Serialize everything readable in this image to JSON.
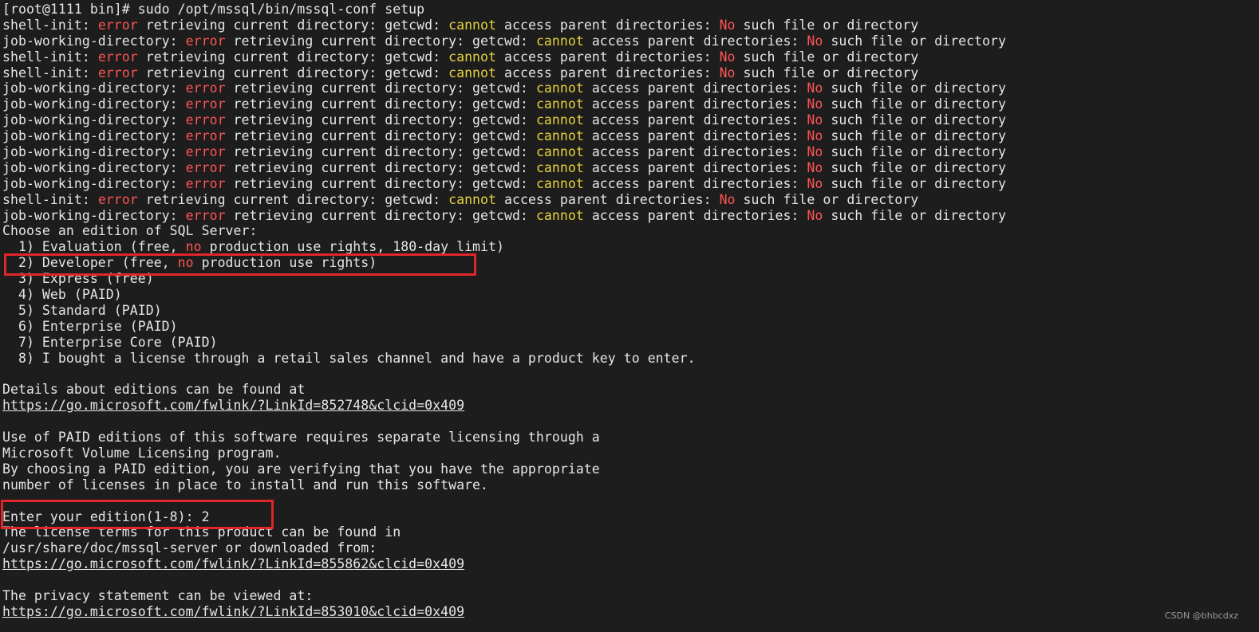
{
  "terminal": {
    "lines": [
      {
        "kind": "prompt",
        "segments": [
          {
            "t": "[root@1111 bin]# sudo /opt/mssql/bin/mssql-conf setup",
            "c": ""
          }
        ]
      },
      {
        "kind": "error",
        "segments": [
          {
            "t": "shell-init: ",
            "c": ""
          },
          {
            "t": "error",
            "c": "red"
          },
          {
            "t": " retrieving current directory: getcwd: ",
            "c": ""
          },
          {
            "t": "cannot",
            "c": "yellow"
          },
          {
            "t": " access parent directories: ",
            "c": ""
          },
          {
            "t": "No",
            "c": "red"
          },
          {
            "t": " such file or directory",
            "c": ""
          }
        ]
      },
      {
        "kind": "error",
        "segments": [
          {
            "t": "job-working-directory: ",
            "c": ""
          },
          {
            "t": "error",
            "c": "red"
          },
          {
            "t": " retrieving current directory: getcwd: ",
            "c": ""
          },
          {
            "t": "cannot",
            "c": "yellow"
          },
          {
            "t": " access parent directories: ",
            "c": ""
          },
          {
            "t": "No",
            "c": "red"
          },
          {
            "t": " such file or directory",
            "c": ""
          }
        ]
      },
      {
        "kind": "error",
        "segments": [
          {
            "t": "shell-init: ",
            "c": ""
          },
          {
            "t": "error",
            "c": "red"
          },
          {
            "t": " retrieving current directory: getcwd: ",
            "c": ""
          },
          {
            "t": "cannot",
            "c": "yellow"
          },
          {
            "t": " access parent directories: ",
            "c": ""
          },
          {
            "t": "No",
            "c": "red"
          },
          {
            "t": " such file or directory",
            "c": ""
          }
        ]
      },
      {
        "kind": "error",
        "segments": [
          {
            "t": "shell-init: ",
            "c": ""
          },
          {
            "t": "error",
            "c": "red"
          },
          {
            "t": " retrieving current directory: getcwd: ",
            "c": ""
          },
          {
            "t": "cannot",
            "c": "yellow"
          },
          {
            "t": " access parent directories: ",
            "c": ""
          },
          {
            "t": "No",
            "c": "red"
          },
          {
            "t": " such file or directory",
            "c": ""
          }
        ]
      },
      {
        "kind": "error",
        "segments": [
          {
            "t": "job-working-directory: ",
            "c": ""
          },
          {
            "t": "error",
            "c": "red"
          },
          {
            "t": " retrieving current directory: getcwd: ",
            "c": ""
          },
          {
            "t": "cannot",
            "c": "yellow"
          },
          {
            "t": " access parent directories: ",
            "c": ""
          },
          {
            "t": "No",
            "c": "red"
          },
          {
            "t": " such file or directory",
            "c": ""
          }
        ]
      },
      {
        "kind": "error",
        "segments": [
          {
            "t": "job-working-directory: ",
            "c": ""
          },
          {
            "t": "error",
            "c": "red"
          },
          {
            "t": " retrieving current directory: getcwd: ",
            "c": ""
          },
          {
            "t": "cannot",
            "c": "yellow"
          },
          {
            "t": " access parent directories: ",
            "c": ""
          },
          {
            "t": "No",
            "c": "red"
          },
          {
            "t": " such file or directory",
            "c": ""
          }
        ]
      },
      {
        "kind": "error",
        "segments": [
          {
            "t": "job-working-directory: ",
            "c": ""
          },
          {
            "t": "error",
            "c": "red"
          },
          {
            "t": " retrieving current directory: getcwd: ",
            "c": ""
          },
          {
            "t": "cannot",
            "c": "yellow"
          },
          {
            "t": " access parent directories: ",
            "c": ""
          },
          {
            "t": "No",
            "c": "red"
          },
          {
            "t": " such file or directory",
            "c": ""
          }
        ]
      },
      {
        "kind": "error",
        "segments": [
          {
            "t": "job-working-directory: ",
            "c": ""
          },
          {
            "t": "error",
            "c": "red"
          },
          {
            "t": " retrieving current directory: getcwd: ",
            "c": ""
          },
          {
            "t": "cannot",
            "c": "yellow"
          },
          {
            "t": " access parent directories: ",
            "c": ""
          },
          {
            "t": "No",
            "c": "red"
          },
          {
            "t": " such file or directory",
            "c": ""
          }
        ]
      },
      {
        "kind": "error",
        "segments": [
          {
            "t": "job-working-directory: ",
            "c": ""
          },
          {
            "t": "error",
            "c": "red"
          },
          {
            "t": " retrieving current directory: getcwd: ",
            "c": ""
          },
          {
            "t": "cannot",
            "c": "yellow"
          },
          {
            "t": " access parent directories: ",
            "c": ""
          },
          {
            "t": "No",
            "c": "red"
          },
          {
            "t": " such file or directory",
            "c": ""
          }
        ]
      },
      {
        "kind": "error",
        "segments": [
          {
            "t": "job-working-directory: ",
            "c": ""
          },
          {
            "t": "error",
            "c": "red"
          },
          {
            "t": " retrieving current directory: getcwd: ",
            "c": ""
          },
          {
            "t": "cannot",
            "c": "yellow"
          },
          {
            "t": " access parent directories: ",
            "c": ""
          },
          {
            "t": "No",
            "c": "red"
          },
          {
            "t": " such file or directory",
            "c": ""
          }
        ]
      },
      {
        "kind": "error",
        "segments": [
          {
            "t": "job-working-directory: ",
            "c": ""
          },
          {
            "t": "error",
            "c": "red"
          },
          {
            "t": " retrieving current directory: getcwd: ",
            "c": ""
          },
          {
            "t": "cannot",
            "c": "yellow"
          },
          {
            "t": " access parent directories: ",
            "c": ""
          },
          {
            "t": "No",
            "c": "red"
          },
          {
            "t": " such file or directory",
            "c": ""
          }
        ]
      },
      {
        "kind": "error",
        "segments": [
          {
            "t": "shell-init: ",
            "c": ""
          },
          {
            "t": "error",
            "c": "red"
          },
          {
            "t": " retrieving current directory: getcwd: ",
            "c": ""
          },
          {
            "t": "cannot",
            "c": "yellow"
          },
          {
            "t": " access parent directories: ",
            "c": ""
          },
          {
            "t": "No",
            "c": "red"
          },
          {
            "t": " such file or directory",
            "c": ""
          }
        ]
      },
      {
        "kind": "error",
        "segments": [
          {
            "t": "job-working-directory: ",
            "c": ""
          },
          {
            "t": "error",
            "c": "red"
          },
          {
            "t": " retrieving current directory: getcwd: ",
            "c": ""
          },
          {
            "t": "cannot",
            "c": "yellow"
          },
          {
            "t": " access parent directories: ",
            "c": ""
          },
          {
            "t": "No",
            "c": "red"
          },
          {
            "t": " such file or directory",
            "c": ""
          }
        ]
      },
      {
        "kind": "text",
        "segments": [
          {
            "t": "Choose an edition of SQL Server:",
            "c": ""
          }
        ]
      },
      {
        "kind": "option",
        "segments": [
          {
            "t": "  1) Evaluation (free, ",
            "c": ""
          },
          {
            "t": "no",
            "c": "red"
          },
          {
            "t": " production use rights, 180-day limit)",
            "c": ""
          }
        ]
      },
      {
        "kind": "option",
        "segments": [
          {
            "t": "  2) Developer (free, ",
            "c": ""
          },
          {
            "t": "no",
            "c": "red"
          },
          {
            "t": " production use rights)",
            "c": ""
          }
        ]
      },
      {
        "kind": "option",
        "segments": [
          {
            "t": "  3) Express (free)",
            "c": ""
          }
        ]
      },
      {
        "kind": "option",
        "segments": [
          {
            "t": "  4) Web (PAID)",
            "c": ""
          }
        ]
      },
      {
        "kind": "option",
        "segments": [
          {
            "t": "  5) Standard (PAID)",
            "c": ""
          }
        ]
      },
      {
        "kind": "option",
        "segments": [
          {
            "t": "  6) Enterprise (PAID)",
            "c": ""
          }
        ]
      },
      {
        "kind": "option",
        "segments": [
          {
            "t": "  7) Enterprise Core (PAID)",
            "c": ""
          }
        ]
      },
      {
        "kind": "option",
        "segments": [
          {
            "t": "  8) I bought a license through a retail sales channel and have a product key to enter.",
            "c": ""
          }
        ]
      },
      {
        "kind": "blank",
        "segments": [
          {
            "t": "",
            "c": ""
          }
        ]
      },
      {
        "kind": "text",
        "segments": [
          {
            "t": "Details about editions can be found at",
            "c": ""
          }
        ]
      },
      {
        "kind": "link",
        "segments": [
          {
            "t": "https://go.microsoft.com/fwlink/?LinkId=852748&clcid=0x409",
            "c": "link"
          }
        ]
      },
      {
        "kind": "blank",
        "segments": [
          {
            "t": "",
            "c": ""
          }
        ]
      },
      {
        "kind": "text",
        "segments": [
          {
            "t": "Use of PAID editions of this software requires separate licensing through a",
            "c": ""
          }
        ]
      },
      {
        "kind": "text",
        "segments": [
          {
            "t": "Microsoft Volume Licensing program.",
            "c": ""
          }
        ]
      },
      {
        "kind": "text",
        "segments": [
          {
            "t": "By choosing a PAID edition, you are verifying that you have the appropriate",
            "c": ""
          }
        ]
      },
      {
        "kind": "text",
        "segments": [
          {
            "t": "number of licenses in place to install and run this software.",
            "c": ""
          }
        ]
      },
      {
        "kind": "blank",
        "segments": [
          {
            "t": "",
            "c": ""
          }
        ]
      },
      {
        "kind": "input",
        "segments": [
          {
            "t": "Enter your edition(1-8): 2",
            "c": ""
          }
        ]
      },
      {
        "kind": "text",
        "segments": [
          {
            "t": "The license terms for this product can be found in",
            "c": ""
          }
        ]
      },
      {
        "kind": "text",
        "segments": [
          {
            "t": "/usr/share/doc/mssql-server or downloaded from:",
            "c": ""
          }
        ]
      },
      {
        "kind": "link",
        "segments": [
          {
            "t": "https://go.microsoft.com/fwlink/?LinkId=855862&clcid=0x409",
            "c": "link"
          }
        ]
      },
      {
        "kind": "blank",
        "segments": [
          {
            "t": "",
            "c": ""
          }
        ]
      },
      {
        "kind": "text",
        "segments": [
          {
            "t": "The privacy statement can be viewed at:",
            "c": ""
          }
        ]
      },
      {
        "kind": "link",
        "segments": [
          {
            "t": "https://go.microsoft.com/fwlink/?LinkId=853010&clcid=0x409",
            "c": "link"
          }
        ]
      }
    ]
  },
  "watermark": "CSDN @bhbcdxz",
  "colors": {
    "background": "#1d1d1d",
    "text": "#e6e6e6",
    "error_red": "#ff5454",
    "warning_yellow": "#e5d23c",
    "highlight_box": "#e0262b"
  }
}
